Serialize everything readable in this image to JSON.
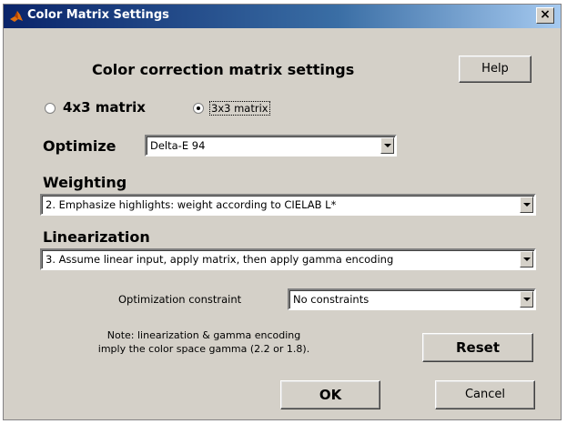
{
  "window": {
    "title": "Color Matrix Settings",
    "close_label": "×"
  },
  "heading": "Color correction matrix settings",
  "help_button": "Help",
  "matrix_options": [
    {
      "label": "4x3 matrix",
      "selected": false
    },
    {
      "label": "3x3 matrix",
      "selected": true
    }
  ],
  "optimize": {
    "label": "Optimize",
    "value": "Delta-E 94"
  },
  "weighting": {
    "label": "Weighting",
    "value": "2.  Emphasize highlights: weight according to CIELAB L*"
  },
  "linearization": {
    "label": "Linearization",
    "value": "3.  Assume linear input, apply matrix, then apply gamma encoding"
  },
  "constraint": {
    "label": "Optimization constraint",
    "value": "No constraints"
  },
  "note": {
    "line1": "Note: linearization & gamma encoding",
    "line2": "imply the color space gamma (2.2 or 1.8)."
  },
  "buttons": {
    "reset": "Reset",
    "ok": "OK",
    "cancel": "Cancel"
  },
  "colors": {
    "titlebar_start": "#0a246a",
    "titlebar_end": "#a6caf0",
    "dialog_bg": "#d4d0c8"
  }
}
